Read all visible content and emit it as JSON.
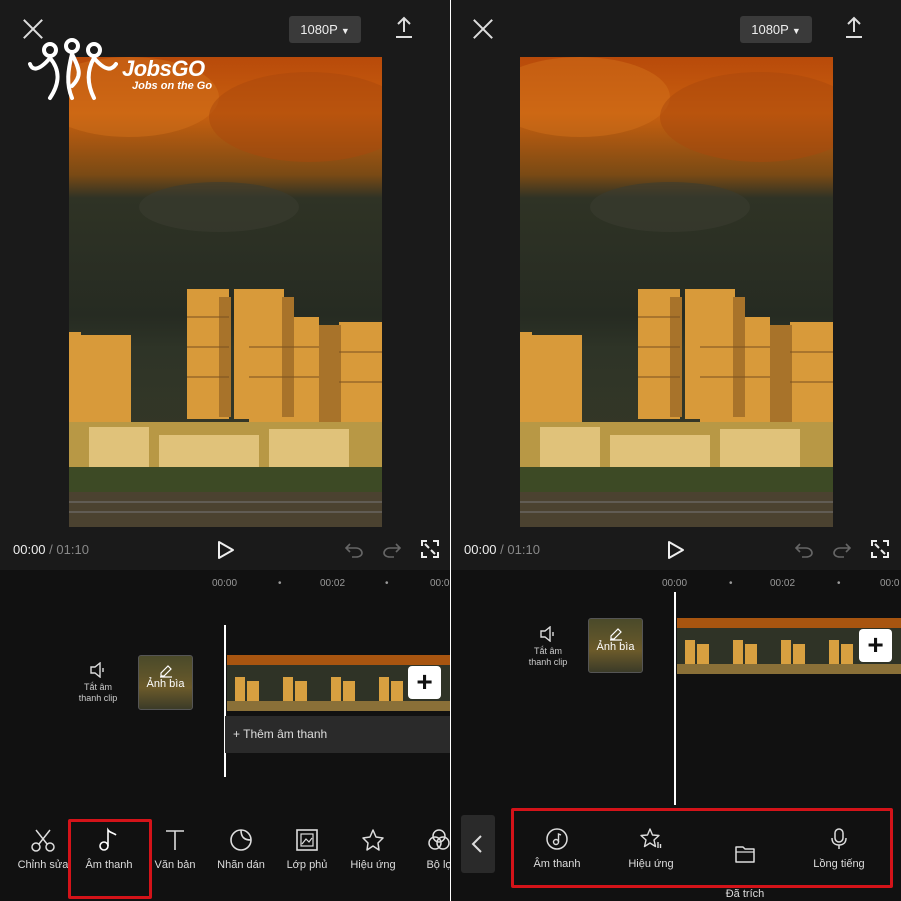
{
  "logo": {
    "brand": "JobsGO",
    "tagline": "Jobs on the Go"
  },
  "left": {
    "resolution": "1080P",
    "time_current": "00:00",
    "time_sep": " / ",
    "time_total": "01:10",
    "ticks": [
      "00:00",
      "•",
      "00:02",
      "•",
      "00:0"
    ],
    "mute_label": "Tắt âm\nthanh clip",
    "cover_label": "Ảnh bìa",
    "add_audio": "+ Thêm âm thanh",
    "tools": [
      {
        "label": "Chỉnh sửa",
        "icon": "scissors-icon"
      },
      {
        "label": "Âm thanh",
        "icon": "music-note-icon"
      },
      {
        "label": "Văn bản",
        "icon": "text-icon"
      },
      {
        "label": "Nhãn dán",
        "icon": "sticker-icon"
      },
      {
        "label": "Lớp phủ",
        "icon": "overlay-icon"
      },
      {
        "label": "Hiệu ứng",
        "icon": "effects-star-icon"
      },
      {
        "label": "Bộ lọ",
        "icon": "filter-icon"
      }
    ],
    "highlight_color": "#d41319"
  },
  "right": {
    "resolution": "1080P",
    "time_current": "00:00",
    "time_sep": " / ",
    "time_total": "01:10",
    "ticks": [
      "00:00",
      "•",
      "00:02",
      "•",
      "00:0"
    ],
    "mute_label": "Tắt âm\nthanh clip",
    "cover_label": "Ảnh bìa",
    "subtools": [
      {
        "label": "Âm thanh",
        "icon": "music-disc-icon"
      },
      {
        "label": "Hiệu ứng",
        "icon": "sound-effect-star-icon"
      },
      {
        "label": "Đã trích\nxuất",
        "icon": "folder-icon"
      },
      {
        "label": "Lồng tiếng",
        "icon": "microphone-icon"
      }
    ]
  }
}
